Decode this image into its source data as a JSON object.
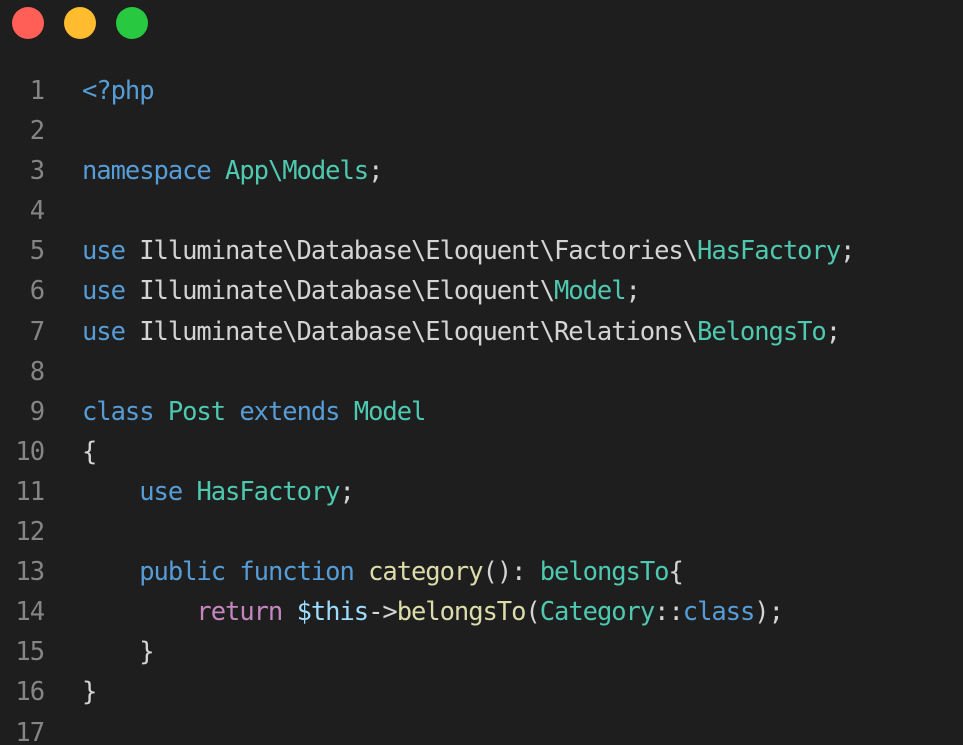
{
  "colors": {
    "background": "#1e1e1e",
    "close_dot": "#ff5f57",
    "minimize_dot": "#febc2e",
    "maximize_dot": "#28c840",
    "line_number": "#858585",
    "keyword": "#569cd6",
    "class_name": "#4ec9b0",
    "function_name": "#dcdcaa",
    "control_keyword": "#c586c0",
    "variable": "#9cdcfe",
    "plain_text": "#d4d4d4"
  },
  "window_controls": {
    "close": "close-icon",
    "minimize": "minimize-icon",
    "maximize": "maximize-icon"
  },
  "code": {
    "language": "php",
    "lines": [
      {
        "number": "1",
        "tokens": [
          {
            "text": "<?php",
            "kind": "kw"
          }
        ]
      },
      {
        "number": "2",
        "tokens": []
      },
      {
        "number": "3",
        "tokens": [
          {
            "text": "namespace",
            "kind": "kw"
          },
          {
            "text": " ",
            "kind": "txt"
          },
          {
            "text": "App\\Models",
            "kind": "cls"
          },
          {
            "text": ";",
            "kind": "pun"
          }
        ]
      },
      {
        "number": "4",
        "tokens": []
      },
      {
        "number": "5",
        "tokens": [
          {
            "text": "use",
            "kind": "kw"
          },
          {
            "text": " Illuminate\\Database\\Eloquent\\Factories\\",
            "kind": "txt"
          },
          {
            "text": "HasFactory",
            "kind": "cls"
          },
          {
            "text": ";",
            "kind": "pun"
          }
        ]
      },
      {
        "number": "6",
        "tokens": [
          {
            "text": "use",
            "kind": "kw"
          },
          {
            "text": " Illuminate\\Database\\Eloquent\\",
            "kind": "txt"
          },
          {
            "text": "Model",
            "kind": "cls"
          },
          {
            "text": ";",
            "kind": "pun"
          }
        ]
      },
      {
        "number": "7",
        "tokens": [
          {
            "text": "use",
            "kind": "kw"
          },
          {
            "text": " Illuminate\\Database\\Eloquent\\Relations\\",
            "kind": "txt"
          },
          {
            "text": "BelongsTo",
            "kind": "cls"
          },
          {
            "text": ";",
            "kind": "pun"
          }
        ]
      },
      {
        "number": "8",
        "tokens": []
      },
      {
        "number": "9",
        "tokens": [
          {
            "text": "class",
            "kind": "kw"
          },
          {
            "text": " ",
            "kind": "txt"
          },
          {
            "text": "Post",
            "kind": "cls"
          },
          {
            "text": " ",
            "kind": "txt"
          },
          {
            "text": "extends",
            "kind": "kw"
          },
          {
            "text": " ",
            "kind": "txt"
          },
          {
            "text": "Model",
            "kind": "cls"
          }
        ]
      },
      {
        "number": "10",
        "tokens": [
          {
            "text": "{",
            "kind": "brc"
          }
        ]
      },
      {
        "number": "11",
        "tokens": [
          {
            "text": "    ",
            "kind": "txt"
          },
          {
            "text": "use",
            "kind": "kw"
          },
          {
            "text": " ",
            "kind": "txt"
          },
          {
            "text": "HasFactory",
            "kind": "cls"
          },
          {
            "text": ";",
            "kind": "pun"
          }
        ]
      },
      {
        "number": "12",
        "tokens": []
      },
      {
        "number": "13",
        "tokens": [
          {
            "text": "    ",
            "kind": "txt"
          },
          {
            "text": "public",
            "kind": "kw"
          },
          {
            "text": " ",
            "kind": "txt"
          },
          {
            "text": "function",
            "kind": "kw"
          },
          {
            "text": " ",
            "kind": "txt"
          },
          {
            "text": "category",
            "kind": "fn"
          },
          {
            "text": "(): ",
            "kind": "pun"
          },
          {
            "text": "belongsTo",
            "kind": "cls"
          },
          {
            "text": "{",
            "kind": "brc"
          }
        ]
      },
      {
        "number": "14",
        "tokens": [
          {
            "text": "        ",
            "kind": "txt"
          },
          {
            "text": "return",
            "kind": "ctl"
          },
          {
            "text": " ",
            "kind": "txt"
          },
          {
            "text": "$this",
            "kind": "var"
          },
          {
            "text": "->",
            "kind": "pun"
          },
          {
            "text": "belongsTo",
            "kind": "fn"
          },
          {
            "text": "(",
            "kind": "pun"
          },
          {
            "text": "Category",
            "kind": "cls"
          },
          {
            "text": "::",
            "kind": "pun"
          },
          {
            "text": "class",
            "kind": "kw"
          },
          {
            "text": ");",
            "kind": "pun"
          }
        ]
      },
      {
        "number": "15",
        "tokens": [
          {
            "text": "    ",
            "kind": "txt"
          },
          {
            "text": "}",
            "kind": "brc"
          }
        ]
      },
      {
        "number": "16",
        "tokens": [
          {
            "text": "}",
            "kind": "brc"
          }
        ]
      },
      {
        "number": "17",
        "tokens": []
      }
    ]
  }
}
